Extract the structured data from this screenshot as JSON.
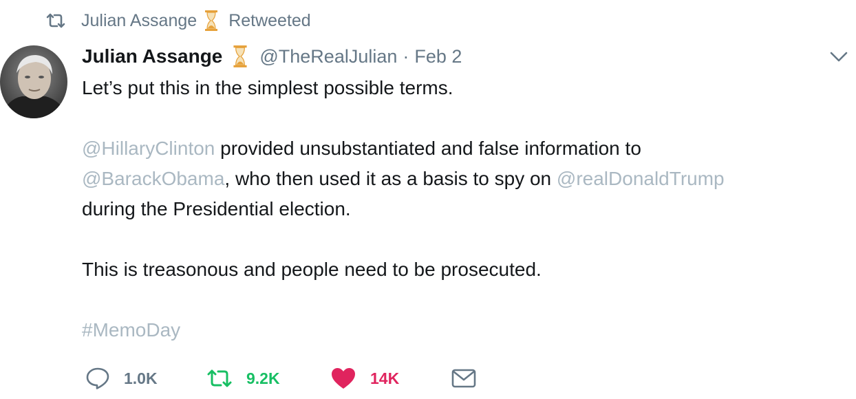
{
  "retweet_context": {
    "retweeter_name": "Julian Assange",
    "label": "Retweeted"
  },
  "tweet": {
    "author_name": "Julian Assange",
    "handle": "@TheRealJulian",
    "separator": "·",
    "date": "Feb 2",
    "text": {
      "line1": "Let’s put this in the simplest possible terms.",
      "mention1": "@HillaryClinton",
      "text2a": " provided unsubstantiated and false information to",
      "mention2": "@BarackObama",
      "text2b": ", who then used it as a basis to spy on ",
      "mention3": "@realDonaldTrump",
      "text2c": "during the Presidential election.",
      "line3": "This is treasonous and people need to be prosecuted.",
      "hashtag": "#MemoDay"
    }
  },
  "actions": {
    "reply_count": "1.0K",
    "retweet_count": "9.2K",
    "like_count": "14K"
  },
  "icons": {
    "retweet_context": "retweet-icon",
    "badge": "hourglass-icon",
    "caret": "chevron-down-icon",
    "reply": "reply-icon",
    "retweet": "retweet-icon",
    "like": "heart-icon",
    "dm": "envelope-icon"
  },
  "colors": {
    "text": "#14171a",
    "secondary": "#657786",
    "mention": "#aab8c2",
    "retweet_green": "#17bf63",
    "like_red": "#e0245e",
    "hourglass_gold": "#e6a13a"
  }
}
